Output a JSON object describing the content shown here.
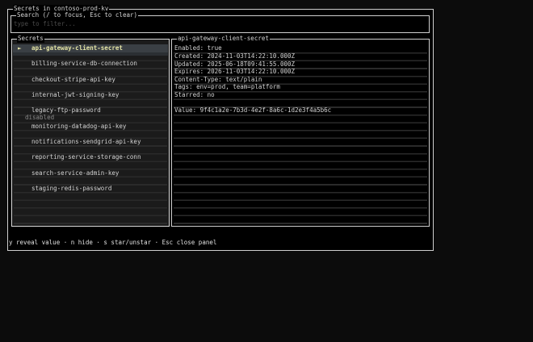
{
  "panel_title": "Secrets in contoso-prod-kv",
  "search": {
    "label": "Search (/ to focus, Esc to clear)",
    "placeholder": "type to filter..."
  },
  "list": {
    "title": "Secrets",
    "selected_marker": "►",
    "items": [
      {
        "name": "api-gateway-client-secret",
        "selected": true
      },
      {
        "name": "billing-service-db-connection"
      },
      {
        "name": "checkout-stripe-api-key"
      },
      {
        "name": "internal-jwt-signing-key"
      },
      {
        "name": "legacy-ftp-password",
        "status": "disabled"
      },
      {
        "name": "monitoring-datadog-api-key"
      },
      {
        "name": "notifications-sendgrid-api-key"
      },
      {
        "name": "reporting-service-storage-conn"
      },
      {
        "name": "search-service-admin-key"
      },
      {
        "name": "staging-redis-password"
      }
    ]
  },
  "details": {
    "title": "api-gateway-client-secret",
    "lines": [
      "Enabled: true",
      "Created: 2024-11-03T14:22:10.000Z",
      "Updated: 2025-06-18T09:41:55.000Z",
      "Expires: 2026-11-03T14:22:10.000Z",
      "Content-Type: text/plain",
      "Tags: env=prod, team=platform",
      "Starred: no",
      "",
      "Value: 9f4c1a2e-7b3d-4e2f-8a6c-1d2e3f4a5b6c"
    ]
  },
  "statusbar": "y reveal value · n hide · s star/unstar · Esc close panel"
}
